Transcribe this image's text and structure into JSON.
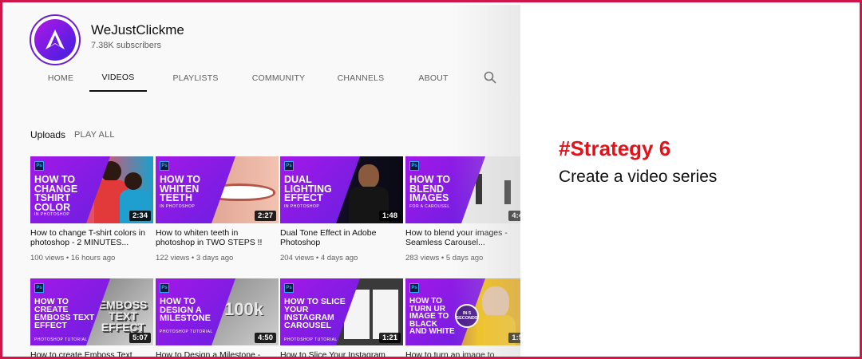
{
  "channel": {
    "name": "WeJustClickme",
    "subscribers": "7.38K subscribers"
  },
  "tabs": [
    "HOME",
    "VIDEOS",
    "PLAYLISTS",
    "COMMUNITY",
    "CHANNELS",
    "ABOUT"
  ],
  "active_tab": "VIDEOS",
  "section": {
    "title": "Uploads",
    "play_all": "PLAY ALL"
  },
  "videos": [
    {
      "thumb_text": "How to change Tshirt color",
      "thumb_sub": "IN PHOTOSHOP",
      "duration": "2:34",
      "title": "How to change T-shirt colors in photoshop - 2 MINUTES...",
      "views": "100 views",
      "age": "16 hours ago"
    },
    {
      "thumb_text": "How to whiten teeth",
      "thumb_sub": "IN PHOTOSHOP",
      "duration": "2:27",
      "title": "How to whiten teeth in photoshop in TWO STEPS !!",
      "views": "122 views",
      "age": "3 days ago"
    },
    {
      "thumb_text": "Dual lighting effect",
      "thumb_sub": "IN PHOTOSHOP",
      "duration": "1:48",
      "title": "Dual Tone Effect in Adobe Photoshop",
      "views": "204 views",
      "age": "4 days ago"
    },
    {
      "thumb_text": "How to blend images",
      "thumb_sub": "FOR A CAROUSEL",
      "duration": "4:4",
      "title": "How to blend your images - Seamless Carousel...",
      "views": "283 views",
      "age": "5 days ago"
    },
    {
      "thumb_text": "How to create emboss text effect",
      "thumb_sub": "PHOTOSHOP TUTORIAL",
      "duration": "5:07",
      "title": "How to create Emboss Text",
      "views": "",
      "age": ""
    },
    {
      "thumb_text": "How to design a milestone",
      "thumb_sub": "PHOTOSHOP TUTORIAL",
      "duration": "4:50",
      "title": "How to Design a Milestone -",
      "views": "",
      "age": ""
    },
    {
      "thumb_text": "How to slice your instagram carousel",
      "thumb_sub": "PHOTOSHOP TUTORIAL",
      "duration": "1:21",
      "title": "How to Slice Your Instagram",
      "views": "",
      "age": ""
    },
    {
      "thumb_text": "How to turn ur image to black and white",
      "thumb_sub": "",
      "duration": "1:5",
      "title": "How to turn an image to",
      "views": "",
      "age": ""
    }
  ],
  "thumb_art": [
    "EMBOSS TEXT EFFECT",
    "100k",
    "IN 5 SECONDS"
  ],
  "headline": {
    "strategy": "#Strategy 6",
    "subtitle": "Create a video series"
  },
  "colors": {
    "accent": "#e1121a",
    "frame_border": "#d1144a",
    "thumb_purple": "#8a1be6"
  },
  "icons": {
    "search": "search-icon",
    "photoshop": "ps-icon"
  }
}
